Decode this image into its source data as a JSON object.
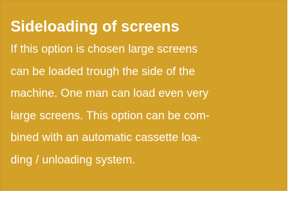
{
  "box": {
    "title": "Sideloading of screens",
    "lines": [
      "If this option is chosen large screens",
      "can be loaded trough the side of the",
      "machine. One man can load even very",
      "large screens. This option can be com-",
      "bined with an automatic cassette loa-",
      "ding / unloading system."
    ],
    "background_color": "#d3a028",
    "text_color": "#ffffff"
  }
}
